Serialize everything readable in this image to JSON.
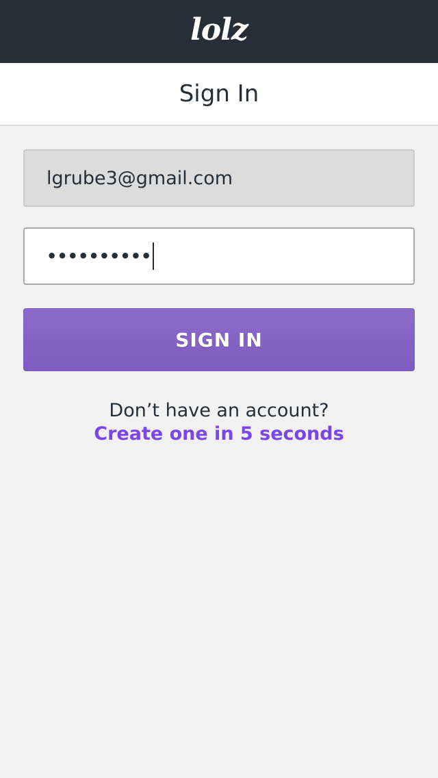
{
  "header": {
    "logo_text": "lolz",
    "background": "#262f37"
  },
  "page": {
    "title": "Sign In"
  },
  "form": {
    "email_value": "lgrube3@gmail.com",
    "password_masked": "••••••••••",
    "submit_label": "SIGN IN",
    "accent_color": "#8466c4"
  },
  "signup": {
    "prompt": "Don’t have an account?",
    "link_text": "Create one in 5 seconds",
    "link_color": "#7a46e8"
  }
}
